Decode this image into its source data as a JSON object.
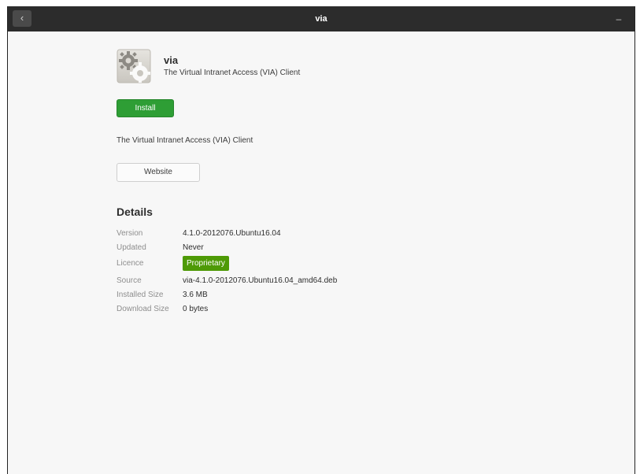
{
  "window": {
    "title": "via",
    "back_glyph": "‹",
    "minimize_glyph": "–",
    "titlebar_color": "#2c2c2c",
    "background_color": "#f7f7f7"
  },
  "app": {
    "name": "via",
    "summary": "The Virtual Intranet Access (VIA) Client",
    "icon": "application-gears-icon"
  },
  "actions": {
    "install_label": "Install",
    "install_color": "#2e9e35",
    "website_label": "Website"
  },
  "description": "The Virtual Intranet Access (VIA) Client",
  "details": {
    "heading": "Details",
    "rows": [
      {
        "label": "Version",
        "value": "4.1.0-2012076.Ubuntu16.04"
      },
      {
        "label": "Updated",
        "value": "Never"
      },
      {
        "label": "Licence",
        "value": "Proprietary",
        "badge_color": "#4e9a06"
      },
      {
        "label": "Source",
        "value": "via-4.1.0-2012076.Ubuntu16.04_amd64.deb"
      },
      {
        "label": "Installed Size",
        "value": "3.6 MB"
      },
      {
        "label": "Download Size",
        "value": "0 bytes"
      }
    ]
  }
}
